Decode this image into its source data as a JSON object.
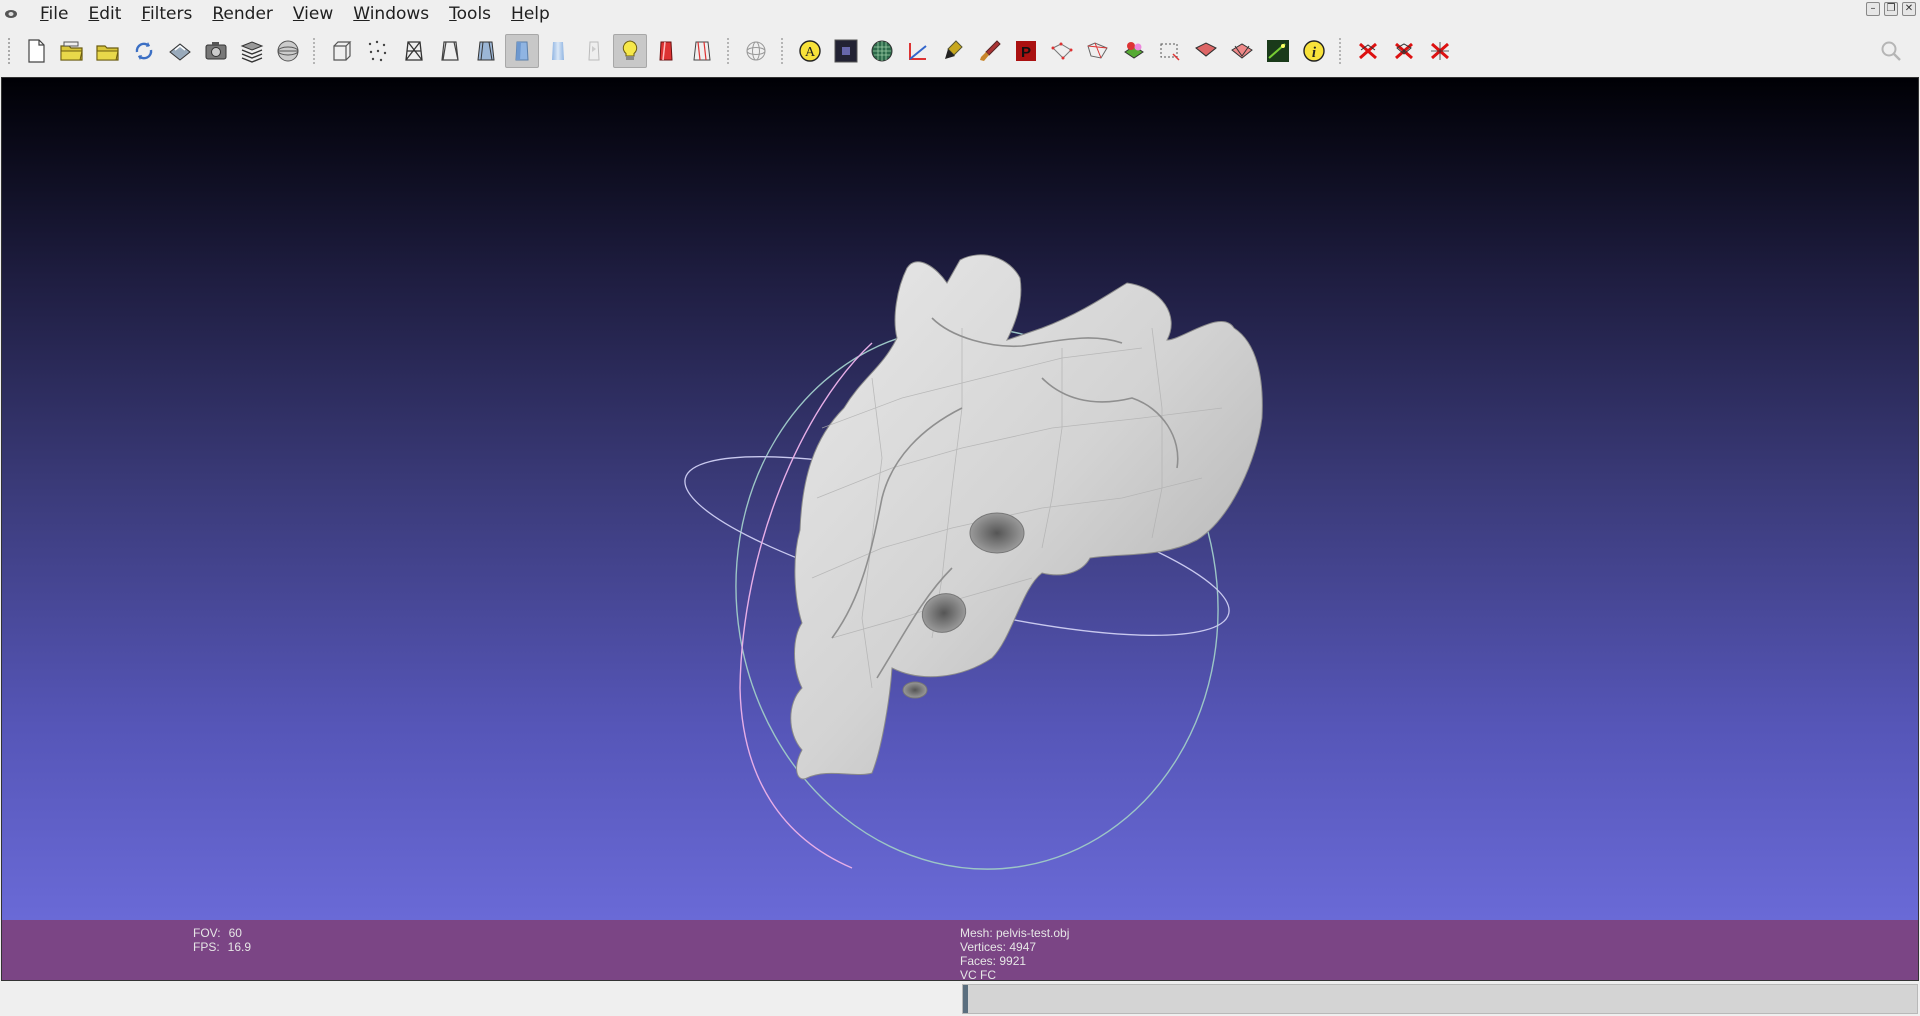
{
  "menubar": {
    "items": [
      {
        "label": "File"
      },
      {
        "label": "Edit"
      },
      {
        "label": "Filters"
      },
      {
        "label": "Render"
      },
      {
        "label": "View"
      },
      {
        "label": "Windows"
      },
      {
        "label": "Tools"
      },
      {
        "label": "Help"
      }
    ]
  },
  "window_controls": {
    "minimize": "–",
    "restore": "❐",
    "close": "✕"
  },
  "toolbar": {
    "groups": [
      [
        "new-project-icon",
        "open-project-icon",
        "import-mesh-icon",
        "reload-icon",
        "export-mesh-icon",
        "snapshot-icon",
        "layers-icon",
        "render-mode-icon"
      ],
      [
        "bbox-icon",
        "points-icon",
        "wireframe-icon",
        "hidden-lines-icon",
        "flat-lines-icon",
        "flat-icon",
        "smooth-icon",
        "texture-icon",
        "light-icon",
        "color-icon",
        "backface-icon"
      ],
      [
        "trackball-icon"
      ],
      [
        "annotate-icon",
        "raster-icon",
        "texture-grid-icon",
        "measure-icon",
        "paint-icon",
        "brush-icon",
        "pick-points-icon",
        "select-vertices-icon",
        "select-connected-icon",
        "z-painting-icon",
        "select-region-icon",
        "select-faces-icon",
        "align-icon",
        "edit-faces-icon",
        "image-alignment-icon",
        "info-icon"
      ],
      [
        "delete-vertices-icon",
        "delete-faces-vertices-icon",
        "delete-faces-icon"
      ]
    ],
    "active": [
      "flat-icon",
      "light-icon"
    ]
  },
  "viewport": {
    "fov_label": "FOV:",
    "fov_value": "60",
    "fps_label": "FPS:",
    "fps_value": "16.9",
    "mesh_line": "Mesh: pelvis-test.obj",
    "vertices_line": "Vertices: 4947",
    "faces_line": "Faces: 9921",
    "attributes_line": "VC FC"
  },
  "colors": {
    "viewport_top": "#000005",
    "viewport_bottom": "#7070e0",
    "info_bar": "#7b4585",
    "mesh": "#d6d6d6"
  }
}
